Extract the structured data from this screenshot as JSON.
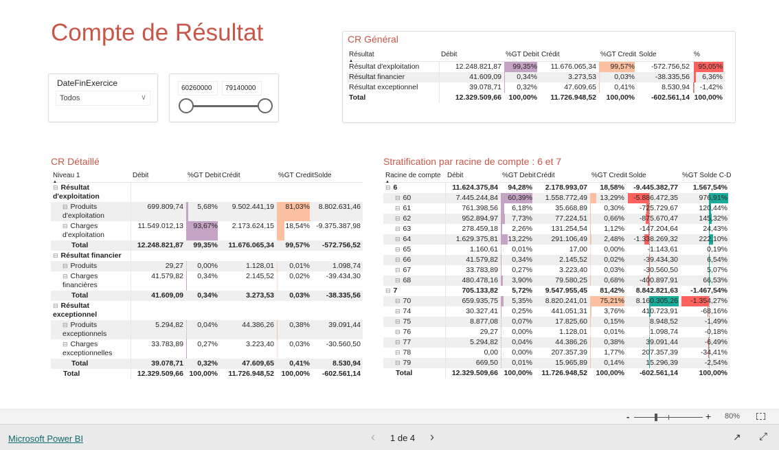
{
  "page_title": "Compte de Résultat",
  "slicer_date": {
    "label": "DateFinExercice",
    "value": "Todos"
  },
  "slicer_range": {
    "min": "60260000",
    "max": "79140000"
  },
  "colors": {
    "title": "#c8574a",
    "debit_bar": "#c5a3c4",
    "credit_bar": "#fcbfa0",
    "negative": "#fd625e",
    "positive": "#1aab9b"
  },
  "cr_general": {
    "title": "CR Général",
    "columns": [
      {
        "label": "Résultat",
        "w": 134
      },
      {
        "label": "Débit",
        "w": 94
      },
      {
        "label": "%GT Debit",
        "w": 52,
        "bar": "pct",
        "color": "#c5a3c4"
      },
      {
        "label": "Crédit",
        "w": 86
      },
      {
        "label": "%GT Credit",
        "w": 56,
        "bar": "pct",
        "color": "#fcbfa0"
      },
      {
        "label": "Solde",
        "w": 80
      },
      {
        "label": "%",
        "w": 48,
        "bar": "div",
        "pos": "#fd625e",
        "neg": "#fd625e"
      }
    ],
    "rows": [
      {
        "type": "item",
        "level": 0,
        "values": [
          "Résultat d'exploitation",
          "12.248.821,87",
          "99,35%",
          "11.676.065,34",
          "99,57%",
          "-572.756,52",
          "95,05%"
        ]
      },
      {
        "type": "item",
        "level": 0,
        "values": [
          "Résultat financier",
          "41.609,09",
          "0,34%",
          "3.273,53",
          "0,03%",
          "-38.335,56",
          "6,36%"
        ]
      },
      {
        "type": "item",
        "level": 0,
        "values": [
          "Résultat exceptionnel",
          "39.078,71",
          "0,32%",
          "47.609,65",
          "0,41%",
          "8.530,94",
          "-1,42%"
        ]
      },
      {
        "type": "grandtotal",
        "level": 0,
        "values": [
          "Total",
          "12.329.509,66",
          "100,00%",
          "11.726.948,52",
          "100,00%",
          "-602.561,14",
          "100,00%"
        ]
      }
    ]
  },
  "cr_detaille": {
    "title": "CR Détaillé",
    "columns": [
      {
        "label": "Niveau 1",
        "w": 116
      },
      {
        "label": "Débit",
        "w": 80
      },
      {
        "label": "%GT Debit",
        "w": 50,
        "bar": "pct",
        "color": "#c5a3c4"
      },
      {
        "label": "Crédit",
        "w": 82
      },
      {
        "label": "%GT Credit",
        "w": 52,
        "bar": "pct",
        "color": "#fcbfa0"
      },
      {
        "label": "Solde",
        "w": 74
      }
    ],
    "rows": [
      {
        "type": "group",
        "level": 0,
        "values": [
          "Résultat d'exploitation",
          "",
          "",
          "",
          "",
          ""
        ]
      },
      {
        "type": "item",
        "level": 1,
        "values": [
          "Produits d'exploitation",
          "699.809,74",
          "5,68%",
          "9.502.441,19",
          "81,03%",
          "8.802.631,46"
        ]
      },
      {
        "type": "item",
        "level": 1,
        "values": [
          "Charges d'exploitation",
          "11.549.012,13",
          "93,67%",
          "2.173.624,15",
          "18,54%",
          "-9.375.387,98"
        ]
      },
      {
        "type": "total",
        "level": 1,
        "values": [
          "Total",
          "12.248.821,87",
          "99,35%",
          "11.676.065,34",
          "99,57%",
          "-572.756,52"
        ]
      },
      {
        "type": "group",
        "level": 0,
        "values": [
          "Résultat financier",
          "",
          "",
          "",
          "",
          ""
        ]
      },
      {
        "type": "item",
        "level": 1,
        "values": [
          "Produits",
          "29,27",
          "0,00%",
          "1.128,01",
          "0,01%",
          "1.098,74"
        ]
      },
      {
        "type": "item",
        "level": 1,
        "values": [
          "Charges financières",
          "41.579,82",
          "0,34%",
          "2.145,52",
          "0,02%",
          "-39.434,30"
        ]
      },
      {
        "type": "total",
        "level": 1,
        "values": [
          "Total",
          "41.609,09",
          "0,34%",
          "3.273,53",
          "0,03%",
          "-38.335,56"
        ]
      },
      {
        "type": "group",
        "level": 0,
        "values": [
          "Résultat exceptionnel",
          "",
          "",
          "",
          "",
          ""
        ]
      },
      {
        "type": "item",
        "level": 1,
        "values": [
          "Produits exceptionnels",
          "5.294,82",
          "0,04%",
          "44.386,26",
          "0,38%",
          "39.091,44"
        ]
      },
      {
        "type": "item",
        "level": 1,
        "values": [
          "Charges exceptionnelles",
          "33.783,89",
          "0,27%",
          "3.223,40",
          "0,03%",
          "-30.560,50"
        ]
      },
      {
        "type": "total",
        "level": 1,
        "values": [
          "Total",
          "39.078,71",
          "0,32%",
          "47.609,65",
          "0,41%",
          "8.530,94"
        ]
      },
      {
        "type": "grandtotal",
        "level": 0,
        "values": [
          "Total",
          "12.329.509,66",
          "100,00%",
          "11.726.948,52",
          "100,00%",
          "-602.561,14"
        ]
      }
    ]
  },
  "stratification": {
    "title": "Stratification par racine de compte : 6 et 7",
    "columns": [
      {
        "label": "Racine de compte",
        "w": 90
      },
      {
        "label": "Débit",
        "w": 80
      },
      {
        "label": "%GT Debit",
        "w": 50,
        "bar": "pct",
        "color": "#c5a3c4"
      },
      {
        "label": "Crédit",
        "w": 80
      },
      {
        "label": "%GT Credit",
        "w": 54,
        "bar": "pct",
        "color": "#fcbfa0"
      },
      {
        "label": "Solde",
        "w": 78,
        "bar": "div",
        "pos": "#1aab9b",
        "neg": "#fd625e"
      },
      {
        "label": "%GT Solde C-D",
        "w": 72,
        "bar": "div",
        "pos": "#1aab9b",
        "neg": "#fd625e"
      }
    ],
    "rows": [
      {
        "type": "group",
        "level": 0,
        "values": [
          "6",
          "11.624.375,84",
          "94,28%",
          "2.178.993,07",
          "18,58%",
          "-9.445.382,77",
          "1.567,54%"
        ]
      },
      {
        "type": "item",
        "level": 1,
        "values": [
          "60",
          "7.445.244,84",
          "60,39%",
          "1.558.772,49",
          "13,29%",
          "-5.886.472,35",
          "976,91%"
        ]
      },
      {
        "type": "item",
        "level": 1,
        "values": [
          "61",
          "761.398,56",
          "6,18%",
          "35.668,89",
          "0,30%",
          "-725.729,67",
          "120,44%"
        ]
      },
      {
        "type": "item",
        "level": 1,
        "values": [
          "62",
          "952.894,97",
          "7,73%",
          "77.224,51",
          "0,66%",
          "-875.670,47",
          "145,32%"
        ]
      },
      {
        "type": "item",
        "level": 1,
        "values": [
          "63",
          "278.459,18",
          "2,26%",
          "131.254,54",
          "1,12%",
          "-147.204,64",
          "24,43%"
        ]
      },
      {
        "type": "item",
        "level": 1,
        "values": [
          "64",
          "1.629.375,81",
          "13,22%",
          "291.106,49",
          "2,48%",
          "-1.338.269,32",
          "222,10%"
        ]
      },
      {
        "type": "item",
        "level": 1,
        "values": [
          "65",
          "1.160,61",
          "0,01%",
          "17,00",
          "0,00%",
          "-1.143,61",
          "0,19%"
        ]
      },
      {
        "type": "item",
        "level": 1,
        "values": [
          "66",
          "41.579,82",
          "0,34%",
          "2.145,52",
          "0,02%",
          "-39.434,30",
          "6,54%"
        ]
      },
      {
        "type": "item",
        "level": 1,
        "values": [
          "67",
          "33.783,89",
          "0,27%",
          "3.223,40",
          "0,03%",
          "-30.560,50",
          "5,07%"
        ]
      },
      {
        "type": "item",
        "level": 1,
        "values": [
          "68",
          "480.478,16",
          "3,90%",
          "79.580,25",
          "0,68%",
          "-400.897,91",
          "66,53%"
        ]
      },
      {
        "type": "group",
        "level": 0,
        "values": [
          "7",
          "705.133,82",
          "5,72%",
          "9.547.955,45",
          "81,42%",
          "8.842.821,63",
          "-1.467,54%"
        ]
      },
      {
        "type": "item",
        "level": 1,
        "values": [
          "70",
          "659.935,75",
          "5,35%",
          "8.820.241,01",
          "75,21%",
          "8.160.305,26",
          "-1.354,27%"
        ]
      },
      {
        "type": "item",
        "level": 1,
        "values": [
          "74",
          "30.327,41",
          "0,25%",
          "441.051,31",
          "3,76%",
          "410.723,91",
          "-68,16%"
        ]
      },
      {
        "type": "item",
        "level": 1,
        "values": [
          "75",
          "8.877,08",
          "0,07%",
          "17.825,60",
          "0,15%",
          "8.948,52",
          "-1,49%"
        ]
      },
      {
        "type": "item",
        "level": 1,
        "values": [
          "76",
          "29,27",
          "0,00%",
          "1.128,01",
          "0,01%",
          "1.098,74",
          "-0,18%"
        ]
      },
      {
        "type": "item",
        "level": 1,
        "values": [
          "77",
          "5.294,82",
          "0,04%",
          "44.386,26",
          "0,38%",
          "39.091,44",
          "-6,49%"
        ]
      },
      {
        "type": "item",
        "level": 1,
        "values": [
          "78",
          "0,00",
          "0,00%",
          "207.357,39",
          "1,77%",
          "207.357,39",
          "-34,41%"
        ]
      },
      {
        "type": "item",
        "level": 1,
        "values": [
          "79",
          "669,50",
          "0,01%",
          "15.965,89",
          "0,14%",
          "15.296,39",
          "-2,54%"
        ]
      },
      {
        "type": "grandtotal",
        "level": 0,
        "values": [
          "Total",
          "12.329.509,66",
          "100,00%",
          "11.726.948,52",
          "100,00%",
          "-602.561,14",
          "100,00%"
        ]
      }
    ]
  },
  "footer": {
    "zoom_minus": "-",
    "zoom_plus": "+",
    "zoom_level": "80%",
    "zoom_fraction": 0.3,
    "brand_link": "Microsoft Power BI",
    "page_indicator": "1 de 4",
    "prev": "‹",
    "next": "›"
  }
}
